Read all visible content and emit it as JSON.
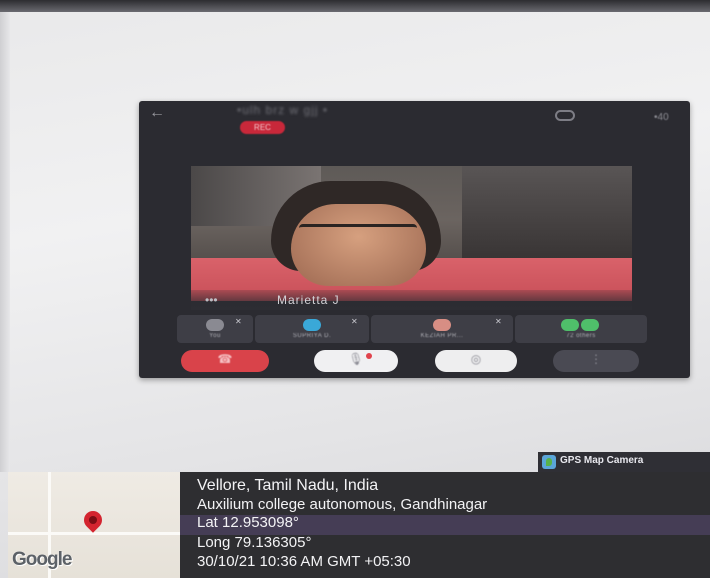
{
  "meeting": {
    "title": "•ulh brz w gjj •",
    "rec_label": "REC",
    "speaker_name": "Marietta J",
    "name_dots": "•••",
    "volume_label": "•40"
  },
  "participants": [
    {
      "label": "You",
      "avatar_color": "#8a8a92"
    },
    {
      "label": "SUPRIYA D.",
      "avatar_color": "#3aa8d8"
    },
    {
      "label": "KEZIAH PR...",
      "avatar_color": "#d78e84"
    },
    {
      "label": "72 others",
      "avatar_color": "#4fbf6a"
    }
  ],
  "controls": {
    "end_call_glyph": "☎",
    "mute_glyph": "🎙",
    "camera_glyph": "◎",
    "more_glyph": "⋮"
  },
  "icons": {
    "back": "back-arrow-icon",
    "camera_switch": "camera-switch-icon",
    "map_pin": "map-pin-icon",
    "gps_app": "gps-map-camera-icon"
  },
  "gps": {
    "app_label": "GPS Map Camera",
    "google_label": "Google",
    "place": "Vellore, Tamil Nadu, India",
    "address": "Auxilium college autonomous, Gandhinagar",
    "lat": "Lat 12.953098°",
    "long": "Long 79.136305°",
    "timestamp": "30/10/21 10:36 AM GMT +05:30"
  },
  "colors": {
    "rec": "#c8283a",
    "end_call": "#d9434a",
    "stamp_bg": "#2e2e31",
    "pin": "#d3242f"
  }
}
